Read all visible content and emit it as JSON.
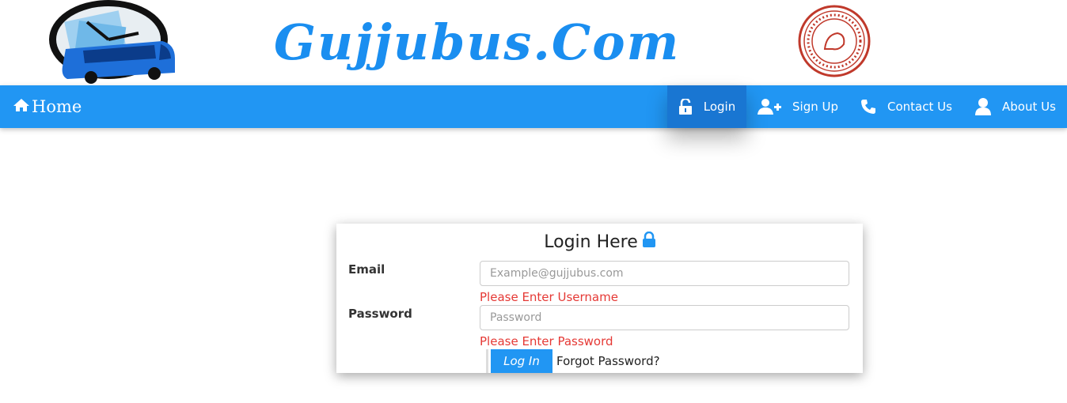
{
  "header": {
    "site_title": "Gujjubus.Com"
  },
  "nav": {
    "home": "Home",
    "login": "Login",
    "signup": "Sign Up",
    "contact": "Contact Us",
    "about": "About Us"
  },
  "login_form": {
    "title": "Login Here",
    "email_label": "Email",
    "email_placeholder": "Example@gujjubus.com",
    "email_value": "",
    "email_error": "Please Enter Username",
    "password_label": "Password",
    "password_placeholder": "Password",
    "password_value": "",
    "password_error": "Please Enter Password",
    "submit_label": "Log In",
    "forgot_label": "Forgot Password?"
  },
  "colors": {
    "navbar": "#2196f3",
    "nav_active": "#1976d2",
    "error": "#e53935",
    "title": "#1a8ef0"
  },
  "icons": [
    "bus-clock-logo",
    "gujarat-seal-emblem",
    "home-icon",
    "unlock-icon",
    "add-user-icon",
    "phone-icon",
    "user-icon",
    "lock-icon"
  ]
}
